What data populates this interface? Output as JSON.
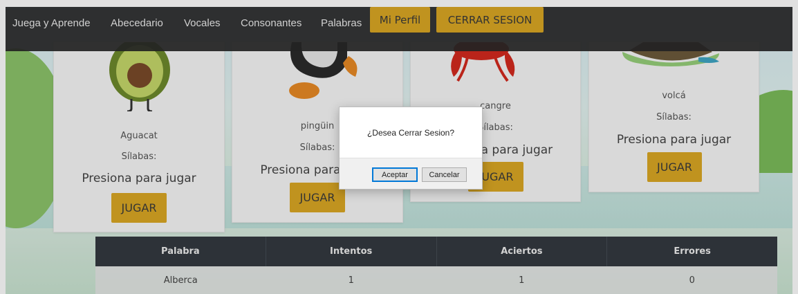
{
  "nav": {
    "brand": "Juega y Aprende",
    "links": [
      "Abecedario",
      "Vocales",
      "Consonantes",
      "Palabras"
    ],
    "profile_button": "Mi Perfil",
    "logout_button": "CERRAR SESION"
  },
  "cards": [
    {
      "name": "Aguacat",
      "syllables_label": "Sílabas:",
      "prompt": "Presiona para jugar",
      "button": "JUGAR"
    },
    {
      "name": "pingüin",
      "syllables_label": "Sílabas:",
      "prompt": "Presiona para jugar",
      "button": "JUGAR"
    },
    {
      "name": "cangre",
      "syllables_label": "Sílabas:",
      "prompt": "Presiona para jugar",
      "button": "JUGAR"
    },
    {
      "name": "volcá",
      "syllables_label": "Sílabas:",
      "prompt": "Presiona para jugar",
      "button": "JUGAR"
    }
  ],
  "table": {
    "headers": [
      "Palabra",
      "Intentos",
      "Aciertos",
      "Errores"
    ],
    "rows": [
      [
        "Alberca",
        "1",
        "1",
        "0"
      ]
    ]
  },
  "dialog": {
    "message": "¿Desea Cerrar Sesion?",
    "ok_label": "Aceptar",
    "cancel_label": "Cancelar"
  },
  "colors": {
    "navbar": "#282828",
    "accent": "#dba824",
    "table_header": "#343a40"
  }
}
